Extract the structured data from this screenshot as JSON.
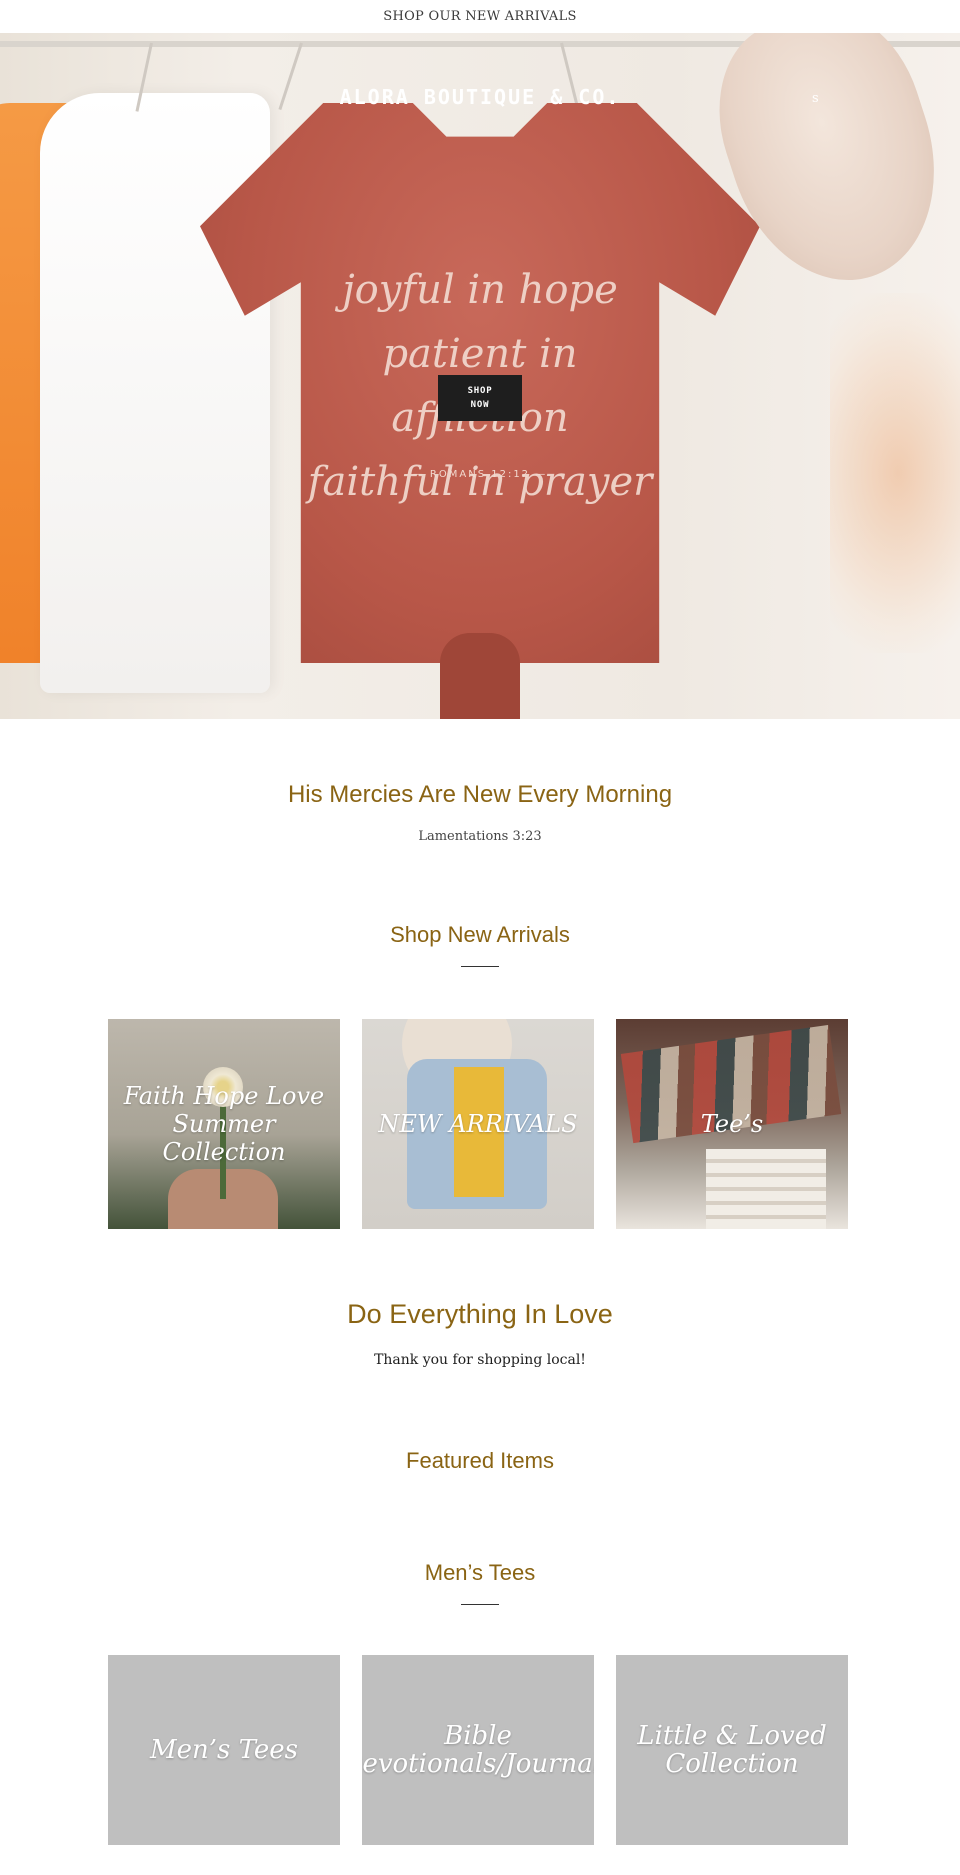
{
  "announcement": {
    "text": "SHOP OUR NEW ARRIVALS"
  },
  "header": {
    "brand": "ALORA BOUTIQUE & CO.",
    "menu_icon": "hamburger-menu-icon",
    "search_label": "s"
  },
  "hero": {
    "verse_lines": "joyful in hope\npatient in affliction\nfaithful in prayer",
    "verse_ref": "— ROMANS 12:12 —",
    "cta_label": "SHOP\nNOW",
    "pause_label": "II",
    "slides": 3,
    "active_slide": 1
  },
  "quote": {
    "title": "His Mercies Are New Every Morning",
    "reference": "Lamentations 3:23"
  },
  "arrivals": {
    "title": "Shop New Arrivals",
    "collections": [
      {
        "label": "Faith Hope Love Summer Collection"
      },
      {
        "label": "NEW ARRIVALS"
      },
      {
        "label": "Tee’s"
      }
    ]
  },
  "love": {
    "title": "Do Everything In Love",
    "subtitle": "Thank you for shopping local!"
  },
  "featured": {
    "title": "Featured Items"
  },
  "mens": {
    "title": "Men’s Tees",
    "collections": [
      {
        "label": "Men’s Tees"
      },
      {
        "label": "Bible Devotionals/Journals"
      },
      {
        "label": "Little & Loved Collection"
      }
    ]
  },
  "colors": {
    "accent_gold": "#8a6414",
    "button_dark": "#1e1e1e",
    "placeholder_grey": "#bfbfbf"
  }
}
